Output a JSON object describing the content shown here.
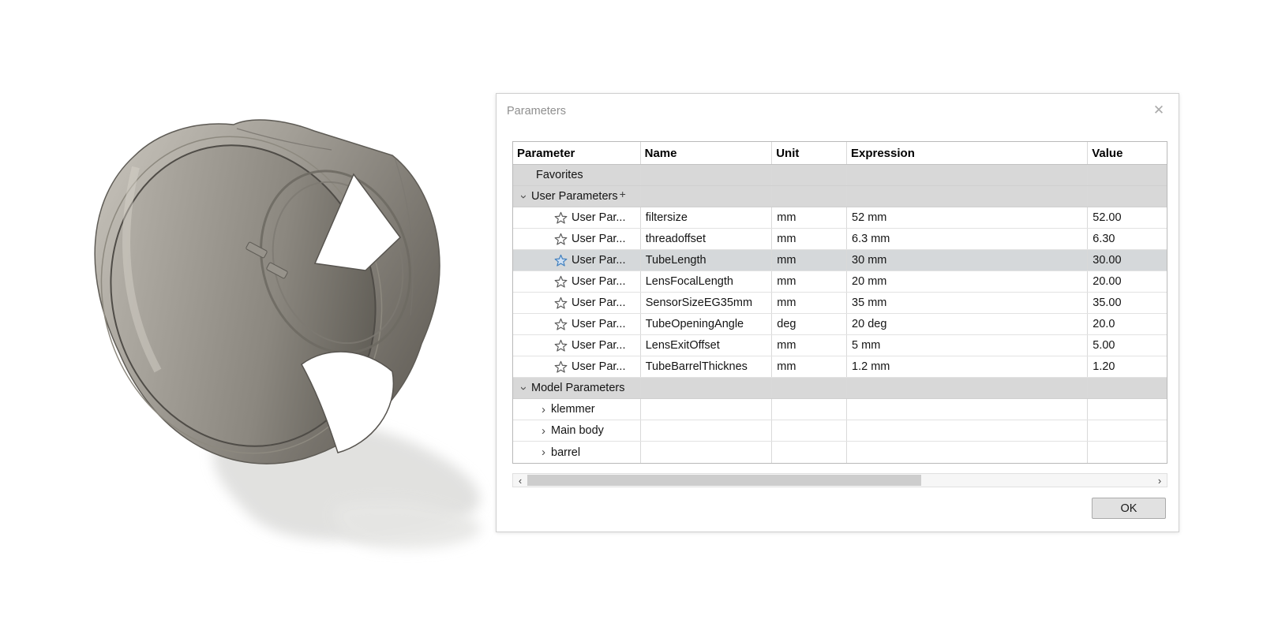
{
  "dialog": {
    "title": "Parameters",
    "ok_label": "OK"
  },
  "icons": {
    "close": "✕",
    "chevron": "›",
    "plus": "+",
    "scroll_left": "‹",
    "scroll_right": "›"
  },
  "colors": {
    "group_row_bg": "#d8d8d8",
    "selected_row_bg": "#d5d8da",
    "selected_star_stroke": "#3f7fbf",
    "selected_star_fill": "#cfe0f3",
    "model_body": "#a39f97",
    "model_shadow": "#dedede"
  },
  "model": {
    "object": "petal-lens-hood-3d-model"
  },
  "table": {
    "columns": [
      "Parameter",
      "Name",
      "Unit",
      "Expression",
      "Value"
    ],
    "rows": [
      {
        "type": "fav",
        "label": "Favorites"
      },
      {
        "type": "group",
        "label": "User Parameters",
        "expander": "down",
        "plus": true
      },
      {
        "type": "param",
        "label": "User Par...",
        "name": "filtersize",
        "unit": "mm",
        "expression": "52 mm",
        "value": "52.00",
        "selected": false
      },
      {
        "type": "param",
        "label": "User Par...",
        "name": "threadoffset",
        "unit": "mm",
        "expression": "6.3 mm",
        "value": "6.30",
        "selected": false
      },
      {
        "type": "param",
        "label": "User Par...",
        "name": "TubeLength",
        "unit": "mm",
        "expression": "30 mm",
        "value": "30.00",
        "selected": true
      },
      {
        "type": "param",
        "label": "User Par...",
        "name": "LensFocalLength",
        "unit": "mm",
        "expression": "20 mm",
        "value": "20.00",
        "selected": false
      },
      {
        "type": "param",
        "label": "User Par...",
        "name": "SensorSizeEG35mm",
        "unit": "mm",
        "expression": "35 mm",
        "value": "35.00",
        "selected": false
      },
      {
        "type": "param",
        "label": "User Par...",
        "name": "TubeOpeningAngle",
        "unit": "deg",
        "expression": "20 deg",
        "value": "20.0",
        "selected": false
      },
      {
        "type": "param",
        "label": "User Par...",
        "name": "LensExitOffset",
        "unit": "mm",
        "expression": "5 mm",
        "value": "5.00",
        "selected": false
      },
      {
        "type": "param",
        "label": "User Par...",
        "name": "TubeBarrelThicknes",
        "unit": "mm",
        "expression": "1.2 mm",
        "value": "1.20",
        "selected": false
      },
      {
        "type": "group",
        "label": "Model Parameters",
        "expander": "down",
        "plus": false
      },
      {
        "type": "child",
        "label": "klemmer",
        "expander": "right"
      },
      {
        "type": "child",
        "label": "Main body",
        "expander": "right"
      },
      {
        "type": "child",
        "label": "barrel",
        "expander": "right"
      }
    ]
  }
}
